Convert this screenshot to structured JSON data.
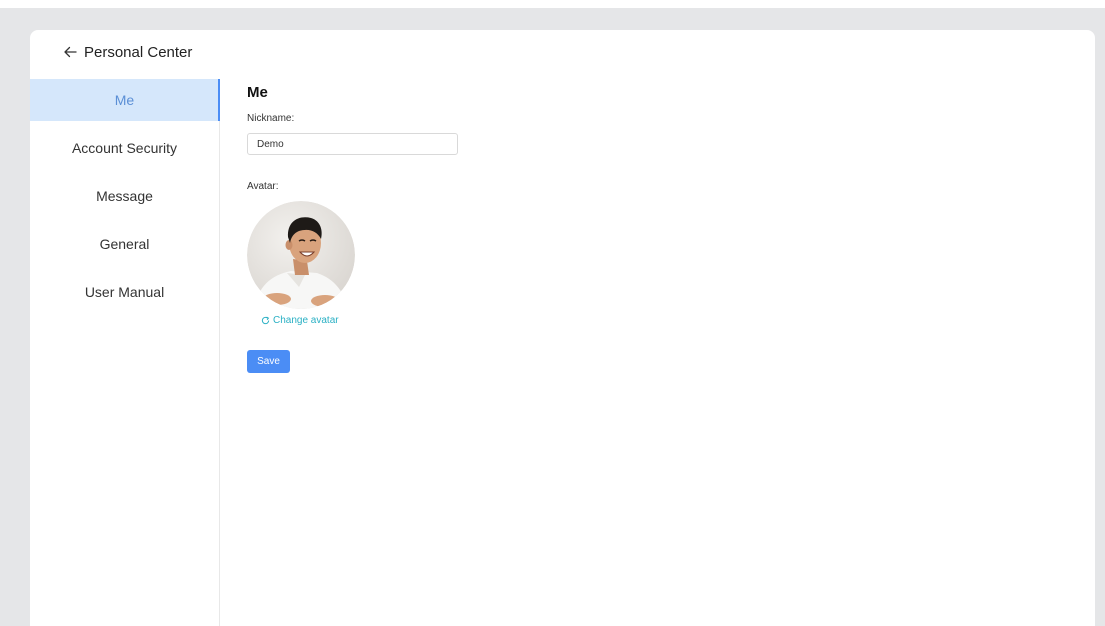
{
  "header": {
    "title": "Personal Center"
  },
  "sidebar": {
    "items": [
      {
        "label": "Me",
        "active": true
      },
      {
        "label": "Account Security",
        "active": false
      },
      {
        "label": "Message",
        "active": false
      },
      {
        "label": "General",
        "active": false
      },
      {
        "label": "User Manual",
        "active": false
      }
    ]
  },
  "profile": {
    "title": "Me",
    "nickname_label": "Nickname:",
    "nickname_value": "Demo",
    "avatar_label": "Avatar:",
    "change_avatar_label": "Change avatar",
    "save_label": "Save"
  },
  "colors": {
    "accent": "#4b8df5",
    "active_bg": "#d5e7fb",
    "link": "#2ab0c4",
    "page_bg": "#e5e6e8"
  },
  "icons": {
    "back": "arrow-left-icon",
    "change": "refresh-icon"
  }
}
